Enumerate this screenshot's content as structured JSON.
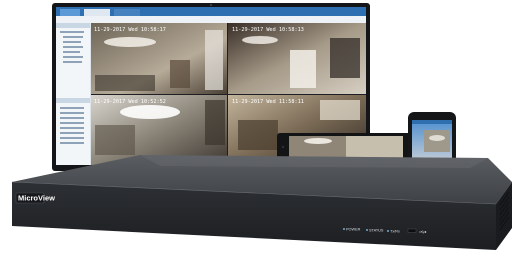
{
  "monitor": {
    "cameras": [
      {
        "timestamp": "11-29-2017 Wed 10:58:17"
      },
      {
        "timestamp": "11-29-2017 Wed 10:58:13"
      },
      {
        "timestamp": "11-29-2017 Wed 10:52:52"
      },
      {
        "timestamp": "11-29-2017 Wed 11:58:11"
      }
    ]
  },
  "nvr": {
    "brand": "MicroView",
    "indicators": {
      "power": "POWER",
      "status": "STATUS",
      "tx_rx": "Tx/Rx"
    },
    "usb_icon": "usb-icon"
  },
  "colors": {
    "ui_blue": "#3d86c6",
    "nvr_body": "#3a3c40",
    "nvr_front": "#25272b"
  }
}
